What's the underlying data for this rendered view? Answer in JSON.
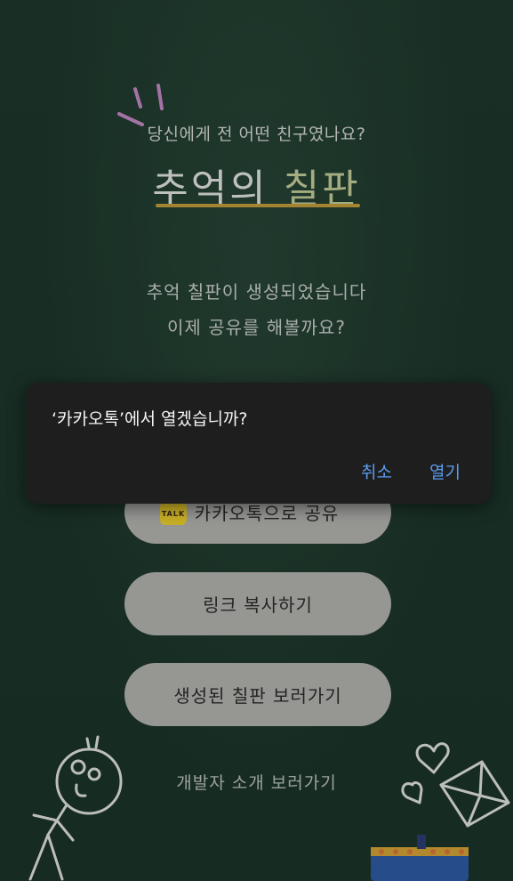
{
  "header": {
    "subtitle": "당신에게 전 어떤 친구였나요?",
    "title_main": "추억의",
    "title_accent": "칠판"
  },
  "message": {
    "line1": "추억 칠판이 생성되었습니다",
    "line2": "이제 공유를 해볼까요?"
  },
  "buttons": {
    "kakao_label": "카카오톡으로 공유",
    "kakao_icon_text": "TALK",
    "copy_link_label": "링크 복사하기",
    "view_board_label": "생성된 칠판 보러가기"
  },
  "footer": {
    "dev_link": "개발자 소개 보러가기"
  },
  "dialog": {
    "message": "‘카카오톡’에서 열겠습니까?",
    "cancel": "취소",
    "open": "열기"
  },
  "colors": {
    "chalkboard": "#203b2f",
    "underline": "#c9a13b",
    "dialog_bg": "#1e1e1f",
    "dialog_button": "#5b9df0",
    "kakao_yellow": "#f3d52f"
  }
}
